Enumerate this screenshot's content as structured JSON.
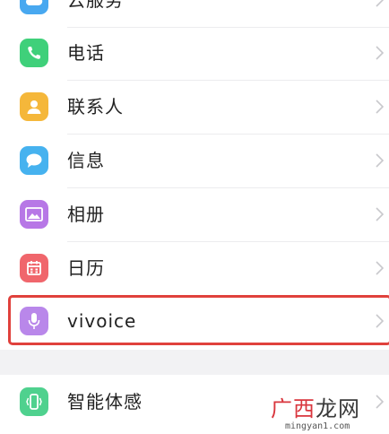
{
  "settings": {
    "items": [
      {
        "label": "云服务",
        "icon": "cloud-icon",
        "color": "#48a8f0"
      },
      {
        "label": "电话",
        "icon": "phone-icon",
        "color": "#3fd07a"
      },
      {
        "label": "联系人",
        "icon": "contact-icon",
        "color": "#f5b73a"
      },
      {
        "label": "信息",
        "icon": "message-icon",
        "color": "#46b2ef"
      },
      {
        "label": "相册",
        "icon": "album-icon",
        "color": "#b777e6"
      },
      {
        "label": "日历",
        "icon": "calendar-icon",
        "color": "#f0666c"
      },
      {
        "label": "vivoice",
        "icon": "microphone-icon",
        "color": "#b987ea"
      },
      {
        "label": "智能体感",
        "icon": "smart-motion-icon",
        "color": "#4fd18e"
      }
    ]
  },
  "highlight": {
    "color": "#e0413c",
    "item": "vivoice"
  },
  "watermark": {
    "logo_part1": "广西",
    "logo_part2": "龙网",
    "url": "mingyan1.com"
  }
}
